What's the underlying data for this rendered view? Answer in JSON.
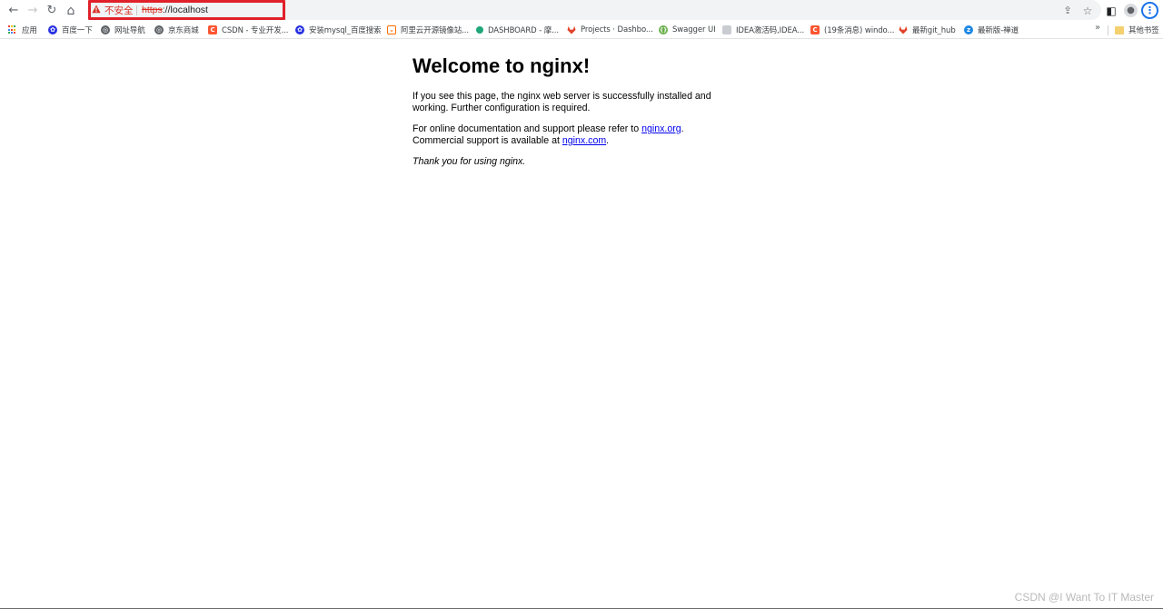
{
  "browser": {
    "nav": {
      "back_icon": "←",
      "forward_icon": "→",
      "reload_icon": "↻",
      "home_icon": "⌂"
    },
    "omnibox": {
      "security_label": "不安全",
      "url_scheme": "https",
      "url_rest": "://localhost",
      "highlight_color": "#e0202a"
    },
    "right_icons": {
      "share_icon": "⇪",
      "bookmark_star_icon": "☆",
      "side_panel_icon": "◧",
      "profile_icon": "●",
      "menu_icon": "⋮"
    }
  },
  "bookmarks": {
    "items": [
      {
        "label": "应用",
        "icon": "apps-grid"
      },
      {
        "label": "百度一下",
        "icon": "baidu-paw",
        "color": "#2932e1"
      },
      {
        "label": "网址导航",
        "icon": "globe",
        "color": "#5f6368"
      },
      {
        "label": "京东商城",
        "icon": "globe",
        "color": "#5f6368"
      },
      {
        "label": "CSDN - 专业开发...",
        "icon": "csdn-c",
        "color": "#fc5531"
      },
      {
        "label": "安装mysql_百度搜索",
        "icon": "baidu-paw",
        "color": "#2932e1"
      },
      {
        "label": "阿里云开源镜像站...",
        "icon": "aliyun",
        "color": "#ff6a00"
      },
      {
        "label": "DASHBOARD - 摩...",
        "icon": "dashboard",
        "color": "#1fa67a"
      },
      {
        "label": "Projects · Dashbo...",
        "icon": "gitlab",
        "color": "#e24329"
      },
      {
        "label": "Swagger UI",
        "icon": "swagger",
        "color": "#85ea2d"
      },
      {
        "label": "IDEA激活码,IDEA...",
        "icon": "idea",
        "color": "#9aa0a6"
      },
      {
        "label": "(19条消息) windo...",
        "icon": "csdn-c",
        "color": "#fc5531"
      },
      {
        "label": "最新git_hub",
        "icon": "gitlab",
        "color": "#e24329"
      },
      {
        "label": "最新版-禅道",
        "icon": "zentao",
        "color": "#1e88e5"
      }
    ],
    "more_icon": "»",
    "other_bookmarks_label": "其他书签"
  },
  "page": {
    "heading": "Welcome to nginx!",
    "para1": "If you see this page, the nginx web server is successfully installed and working. Further configuration is required.",
    "para2_prefix": "For online documentation and support please refer to ",
    "link_org": "nginx.org",
    "para2_mid": ".",
    "para2_line2_prefix": "Commercial support is available at ",
    "link_com": "nginx.com",
    "para2_suffix": ".",
    "thanks": "Thank you for using nginx."
  },
  "watermark": "CSDN @I Want To IT Master"
}
